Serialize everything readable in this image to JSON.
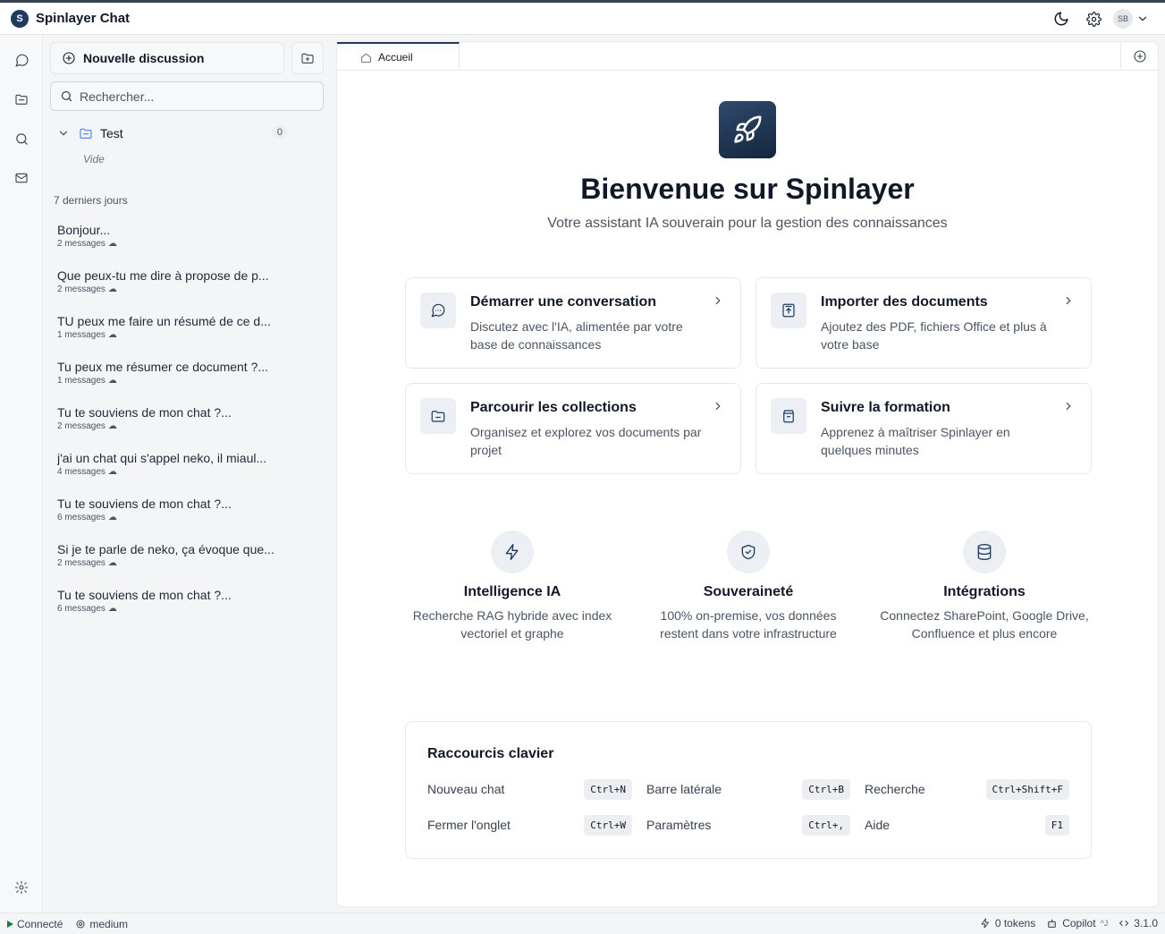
{
  "app": {
    "logo_letter": "S",
    "title": "Spinlayer Chat",
    "avatar_initials": "SB"
  },
  "sidebar": {
    "new_chat_label": "Nouvelle discussion",
    "search_placeholder": "Rechercher...",
    "folder": {
      "name": "Test",
      "count": "0",
      "empty_label": "Vide"
    },
    "section_label": "7 derniers jours",
    "conversations": [
      {
        "title": "Bonjour...",
        "meta": "2 messages"
      },
      {
        "title": "Que peux-tu me dire à propose de p...",
        "meta": "2 messages"
      },
      {
        "title": "TU peux me faire un résumé de ce d...",
        "meta": "1 messages"
      },
      {
        "title": "Tu peux me résumer ce document ?...",
        "meta": "1 messages"
      },
      {
        "title": "Tu te souviens de mon chat ?...",
        "meta": "2 messages"
      },
      {
        "title": "j'ai un chat qui s'appel neko, il miaul...",
        "meta": "4 messages"
      },
      {
        "title": "Tu te souviens de mon chat ?...",
        "meta": "6 messages"
      },
      {
        "title": "Si je te parle de neko, ça évoque que...",
        "meta": "2 messages"
      },
      {
        "title": "Tu te souviens de mon chat ?...",
        "meta": "6 messages"
      }
    ]
  },
  "tabs": [
    {
      "label": "Accueil"
    }
  ],
  "home": {
    "title": "Bienvenue sur Spinlayer",
    "subtitle": "Votre assistant IA souverain pour la gestion des connaissances",
    "cards": [
      {
        "title": "Démarrer une conversation",
        "desc": "Discutez avec l'IA, alimentée par votre base de connaissances",
        "icon": "message-circle-icon"
      },
      {
        "title": "Importer des documents",
        "desc": "Ajoutez des PDF, fichiers Office et plus à votre base",
        "icon": "upload-file-icon"
      },
      {
        "title": "Parcourir les collections",
        "desc": "Organisez et explorez vos documents par projet",
        "icon": "folder-icon"
      },
      {
        "title": "Suivre la formation",
        "desc": "Apprenez à maîtriser Spinlayer en quelques minutes",
        "icon": "book-icon"
      }
    ],
    "features": [
      {
        "title": "Intelligence IA",
        "desc": "Recherche RAG hybride avec index vectoriel et graphe",
        "icon": "zap-icon"
      },
      {
        "title": "Souveraineté",
        "desc": "100% on-premise, vos données restent dans votre infrastructure",
        "icon": "shield-check-icon"
      },
      {
        "title": "Intégrations",
        "desc": "Connectez SharePoint, Google Drive, Confluence et plus encore",
        "icon": "database-icon"
      }
    ],
    "shortcuts": {
      "title": "Raccourcis clavier",
      "items": [
        {
          "label": "Nouveau chat",
          "key": "Ctrl+N"
        },
        {
          "label": "Barre latérale",
          "key": "Ctrl+B"
        },
        {
          "label": "Recherche",
          "key": "Ctrl+Shift+F"
        },
        {
          "label": "Fermer l'onglet",
          "key": "Ctrl+W"
        },
        {
          "label": "Paramètres",
          "key": "Ctrl+,"
        },
        {
          "label": "Aide",
          "key": "F1"
        }
      ]
    }
  },
  "status": {
    "connection": "Connecté",
    "model": "medium",
    "tokens": "0 tokens",
    "copilot": "Copilot",
    "copilot_shortcut": "^J",
    "version": "3.1.0"
  },
  "colors": {
    "accent": "#1e3a5f",
    "status_ok": "#15803d"
  }
}
